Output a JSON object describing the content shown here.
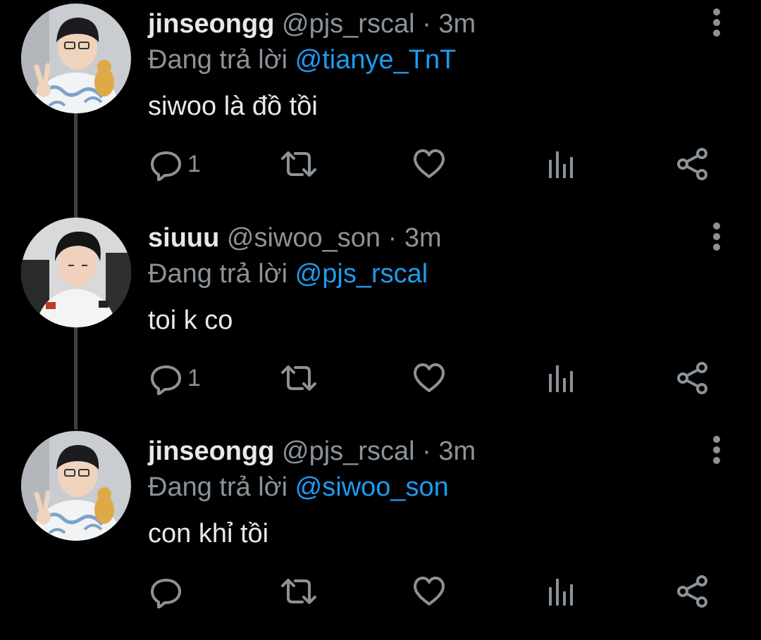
{
  "tweets": [
    {
      "display_name": "jinseongg",
      "handle": "@pjs_rscal",
      "separator": " · ",
      "time": "3m",
      "reply_prefix": "Đang trả lời ",
      "reply_to": "@tianye_TnT",
      "text": "siwoo là đồ tồi",
      "reply_count": "1",
      "avatar": "avatar-jinseongg"
    },
    {
      "display_name": "siuuu",
      "handle": "@siwoo_son",
      "separator": " · ",
      "time": "3m",
      "reply_prefix": "Đang trả lời ",
      "reply_to": "@pjs_rscal",
      "text": "toi k co",
      "reply_count": "1",
      "avatar": "avatar-siuuu"
    },
    {
      "display_name": "jinseongg",
      "handle": "@pjs_rscal",
      "separator": " · ",
      "time": "3m",
      "reply_prefix": "Đang trả lời ",
      "reply_to": "@siwoo_son",
      "text": "con khỉ tồi",
      "reply_count": "",
      "avatar": "avatar-jinseongg"
    }
  ],
  "icons": {
    "reply": "reply-icon",
    "retweet": "retweet-icon",
    "like": "heart-icon",
    "stats": "stats-icon",
    "share": "share-icon",
    "more": "more-vertical-icon"
  },
  "colors": {
    "background": "#000000",
    "text_primary": "#e7e9ea",
    "text_secondary": "#8b9399",
    "mention": "#1d9bf0",
    "thread_line": "#3e4144"
  }
}
